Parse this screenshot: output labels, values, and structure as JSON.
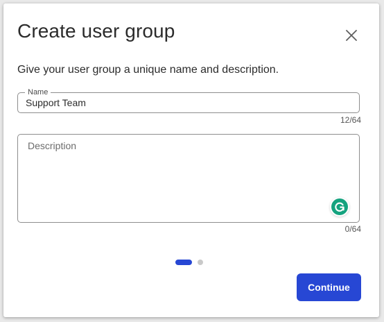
{
  "dialog": {
    "title": "Create user group",
    "subtitle": "Give your user group a unique name and description.",
    "close_icon": "close-icon"
  },
  "name_field": {
    "label": "Name",
    "value": "Support Team",
    "counter": "12/64"
  },
  "description_field": {
    "placeholder": "Description",
    "value": "",
    "counter": "0/64",
    "assistant_icon": "grammarly-icon"
  },
  "pagination": {
    "current_step": 1,
    "total_steps": 2
  },
  "actions": {
    "continue_label": "Continue"
  },
  "colors": {
    "primary": "#2747d4",
    "grammarly": "#15a37f",
    "inactive_dot": "#c9c9c9"
  }
}
